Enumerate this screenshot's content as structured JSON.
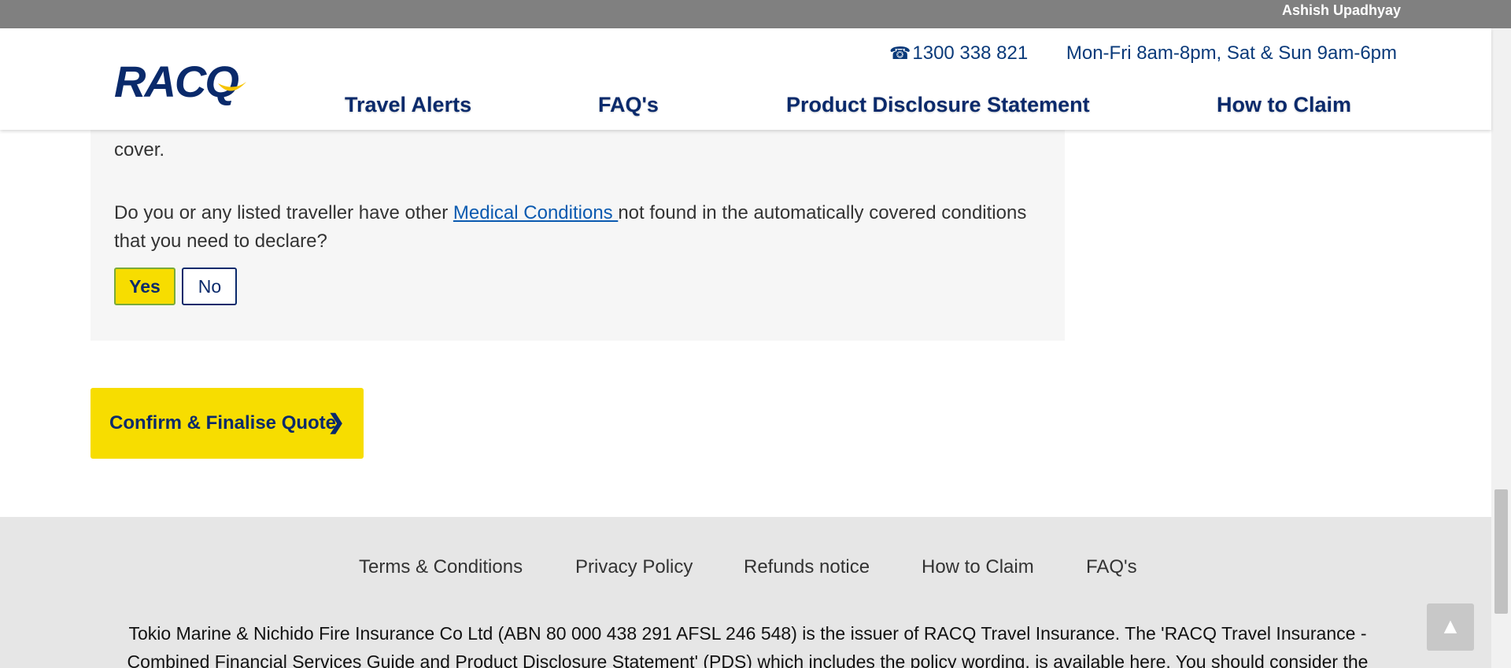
{
  "topbar": {
    "user_name": "Ashish Upadhyay"
  },
  "header": {
    "logo_text": "RACQ",
    "phone": "1300 338 821",
    "hours": "Mon-Fri 8am-8pm, Sat & Sun 9am-6pm",
    "nav": [
      "Travel Alerts",
      "FAQ's",
      "Product Disclosure Statement",
      "How to Claim"
    ]
  },
  "panel": {
    "cover_text": "cover.",
    "question_prefix": "Do you or any listed traveller have other ",
    "question_link": "Medical Conditions ",
    "question_suffix": "not found in the automatically covered conditions that you need to declare?",
    "yes_label": "Yes",
    "no_label": "No",
    "selected": "Yes"
  },
  "actions": {
    "confirm_label": "Confirm & Finalise Quote"
  },
  "footer": {
    "links": [
      "Terms & Conditions",
      "Privacy Policy",
      "Refunds notice",
      "How to Claim",
      "FAQ's"
    ],
    "legal_text": "Tokio Marine & Nichido Fire Insurance Co Ltd (ABN 80 000 438 291 AFSL 246 548) is the issuer of RACQ Travel Insurance. The 'RACQ Travel Insurance - Combined Financial Services Guide and Product Disclosure Statement' (PDS) which includes the policy wording, is available here. You should consider the"
  },
  "colors": {
    "brand_navy": "#0a2a6b",
    "accent_yellow": "#f7dd00",
    "link_blue": "#0b5ab0"
  },
  "icons": {
    "phone": "phone-icon",
    "chevron": "chevron-right-icon",
    "back_to_top": "chevron-up-icon"
  }
}
